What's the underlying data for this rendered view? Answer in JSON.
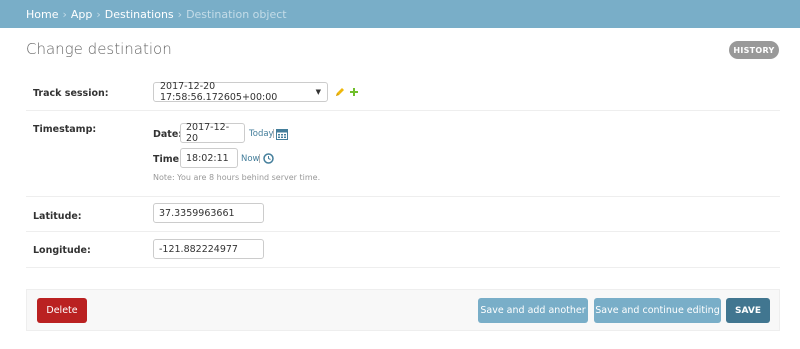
{
  "breadcrumbs": {
    "home": "Home",
    "app": "App",
    "destinations": "Destinations",
    "separator": "›",
    "current": "Destination object"
  },
  "page": {
    "title": "Change destination",
    "history_label": "HISTORY"
  },
  "form": {
    "track_session": {
      "label": "Track session:",
      "value": "2017-12-20 17:58:56.172605+00:00"
    },
    "timestamp": {
      "label": "Timestamp:",
      "date_label": "Date:",
      "date_value": "2017-12-20",
      "today_link": "Today",
      "time_label": "Time:",
      "time_value": "18:02:11",
      "now_link": "Now",
      "link_separator": "|",
      "help_note": "Note: You are 8 hours behind server time."
    },
    "latitude": {
      "label": "Latitude:",
      "value": "37.3359963661"
    },
    "longitude": {
      "label": "Longitude:",
      "value": "-121.882224977"
    }
  },
  "actions": {
    "delete": "Delete",
    "save_add_another": "Save and add another",
    "save_continue": "Save and continue editing",
    "save": "SAVE"
  },
  "colors": {
    "header_bg": "#79aec8",
    "delete_bg": "#ba2121",
    "button_bg": "#79aec8",
    "save_bg": "#417690",
    "link": "#447e9b",
    "pencil": "#efb80b",
    "plus": "#70bf2b"
  },
  "icons": {
    "change_related": "pencil-icon",
    "add_related": "plus-icon",
    "calendar": "calendar-icon",
    "clock": "clock-icon",
    "select_arrow": "chevron-down-icon"
  }
}
